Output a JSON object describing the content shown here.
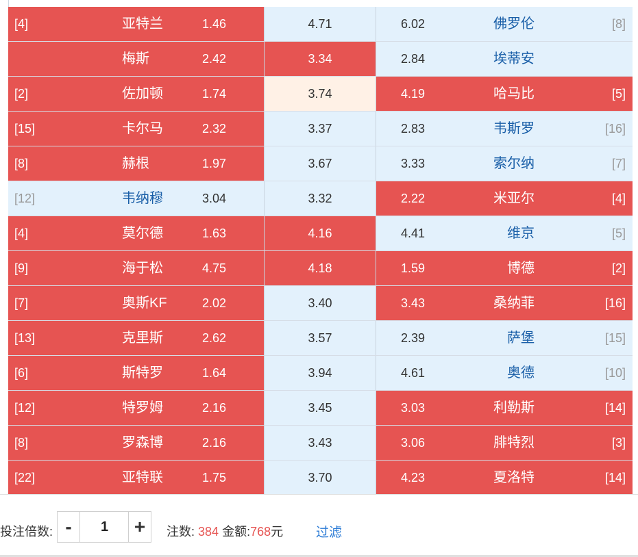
{
  "colors": {
    "hot": "#e65452",
    "cold": "#e3f1fc",
    "mid": "#fff1e6",
    "link": "#2b7bd6"
  },
  "matches": [
    {
      "home_rank": "[4]",
      "home": "亚特兰",
      "home_odd": "1.46",
      "draw": "4.71",
      "away_odd": "6.02",
      "away": "佛罗伦",
      "away_rank": "[8]",
      "home_sel": true,
      "draw_sel": false,
      "away_sel": false,
      "draw_mid": false
    },
    {
      "home_rank": "",
      "home": "梅斯",
      "home_odd": "2.42",
      "draw": "3.34",
      "away_odd": "2.84",
      "away": "埃蒂安",
      "away_rank": "",
      "home_sel": true,
      "draw_sel": true,
      "away_sel": false,
      "draw_mid": false
    },
    {
      "home_rank": "[2]",
      "home": "佐加顿",
      "home_odd": "1.74",
      "draw": "3.74",
      "away_odd": "4.19",
      "away": "哈马比",
      "away_rank": "[5]",
      "home_sel": true,
      "draw_sel": false,
      "away_sel": true,
      "draw_mid": true
    },
    {
      "home_rank": "[15]",
      "home": "卡尔马",
      "home_odd": "2.32",
      "draw": "3.37",
      "away_odd": "2.83",
      "away": "韦斯罗",
      "away_rank": "[16]",
      "home_sel": true,
      "draw_sel": false,
      "away_sel": false,
      "draw_mid": false
    },
    {
      "home_rank": "[8]",
      "home": "赫根",
      "home_odd": "1.97",
      "draw": "3.67",
      "away_odd": "3.33",
      "away": "索尔纳",
      "away_rank": "[7]",
      "home_sel": true,
      "draw_sel": false,
      "away_sel": false,
      "draw_mid": false
    },
    {
      "home_rank": "[12]",
      "home": "韦纳穆",
      "home_odd": "3.04",
      "draw": "3.32",
      "away_odd": "2.22",
      "away": "米亚尔",
      "away_rank": "[4]",
      "home_sel": false,
      "draw_sel": false,
      "away_sel": true,
      "draw_mid": false
    },
    {
      "home_rank": "[4]",
      "home": "莫尔德",
      "home_odd": "1.63",
      "draw": "4.16",
      "away_odd": "4.41",
      "away": "维京",
      "away_rank": "[5]",
      "home_sel": true,
      "draw_sel": true,
      "away_sel": false,
      "draw_mid": false
    },
    {
      "home_rank": "[9]",
      "home": "海于松",
      "home_odd": "4.75",
      "draw": "4.18",
      "away_odd": "1.59",
      "away": "博德",
      "away_rank": "[2]",
      "home_sel": true,
      "draw_sel": true,
      "away_sel": true,
      "draw_mid": false
    },
    {
      "home_rank": "[7]",
      "home": "奥斯KF",
      "home_odd": "2.02",
      "draw": "3.40",
      "away_odd": "3.43",
      "away": "桑纳菲",
      "away_rank": "[16]",
      "home_sel": true,
      "draw_sel": false,
      "away_sel": true,
      "draw_mid": false
    },
    {
      "home_rank": "[13]",
      "home": "克里斯",
      "home_odd": "2.62",
      "draw": "3.57",
      "away_odd": "2.39",
      "away": "萨堡",
      "away_rank": "[15]",
      "home_sel": true,
      "draw_sel": false,
      "away_sel": false,
      "draw_mid": false
    },
    {
      "home_rank": "[6]",
      "home": "斯特罗",
      "home_odd": "1.64",
      "draw": "3.94",
      "away_odd": "4.61",
      "away": "奥德",
      "away_rank": "[10]",
      "home_sel": true,
      "draw_sel": false,
      "away_sel": false,
      "draw_mid": false
    },
    {
      "home_rank": "[12]",
      "home": "特罗姆",
      "home_odd": "2.16",
      "draw": "3.45",
      "away_odd": "3.03",
      "away": "利勒斯",
      "away_rank": "[14]",
      "home_sel": true,
      "draw_sel": false,
      "away_sel": true,
      "draw_mid": false
    },
    {
      "home_rank": "[8]",
      "home": "罗森博",
      "home_odd": "2.16",
      "draw": "3.43",
      "away_odd": "3.06",
      "away": "腓特烈",
      "away_rank": "[3]",
      "home_sel": true,
      "draw_sel": false,
      "away_sel": true,
      "draw_mid": false
    },
    {
      "home_rank": "[22]",
      "home": "亚特联",
      "home_odd": "1.75",
      "draw": "3.70",
      "away_odd": "4.23",
      "away": "夏洛特",
      "away_rank": "[14]",
      "home_sel": true,
      "draw_sel": false,
      "away_sel": true,
      "draw_mid": false
    }
  ],
  "footer": {
    "multiplier_label": "投注倍数:",
    "multiplier_value": "1",
    "minus": "-",
    "plus": "+",
    "count_label": "注数:",
    "count": "384",
    "amount_label": "金额:",
    "amount": "768",
    "currency": "元",
    "filter": "过滤"
  }
}
